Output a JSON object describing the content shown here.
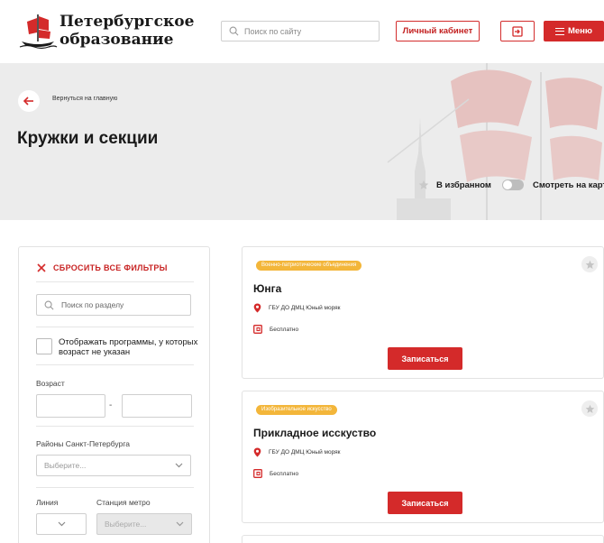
{
  "header": {
    "brand_line1": "Петербургское",
    "brand_line2": "образование",
    "search_placeholder": "Поиск по сайту",
    "cabinet_label": "Личный кабинет",
    "menu_label": "Меню",
    "icons": [
      "ship-logo-icon",
      "search-icon",
      "login-icon",
      "burger-icon"
    ],
    "accent": "#d42a2a"
  },
  "hero": {
    "back_label": "Вернуться на главную",
    "title": "Кружки и секции",
    "favorites_label": "В избранном",
    "map_label": "Смотреть на карте",
    "background": "#ececec"
  },
  "filters": {
    "reset_label": "СБРОСИТЬ ВСЕ ФИЛЬТРЫ",
    "section_search_placeholder": "Поиск по разделу",
    "no_age_label": "Отображать программы, у которых возраст не указан",
    "age_label": "Возраст",
    "age_separator": "-",
    "district_label": "Районы Санкт-Петербурга",
    "district_placeholder": "Выберите...",
    "line_label": "Линия",
    "metro_label": "Станция метро",
    "metro_placeholder": "Выберите..."
  },
  "cards": [
    {
      "category": "Военно-патриотические объединения",
      "title": "Юнга",
      "org": "ГБУ ДО ДМЦ Юный моряк",
      "price": "Бесплатно",
      "button": "Записаться"
    },
    {
      "category": "Изобразительное искусство",
      "title": "Прикладное исскуство",
      "org": "ГБУ ДО ДМЦ Юный моряк",
      "price": "Бесплатно",
      "button": "Записаться"
    }
  ],
  "colors": {
    "badge": "#f3b63a",
    "primary_red": "#d42a2a"
  }
}
